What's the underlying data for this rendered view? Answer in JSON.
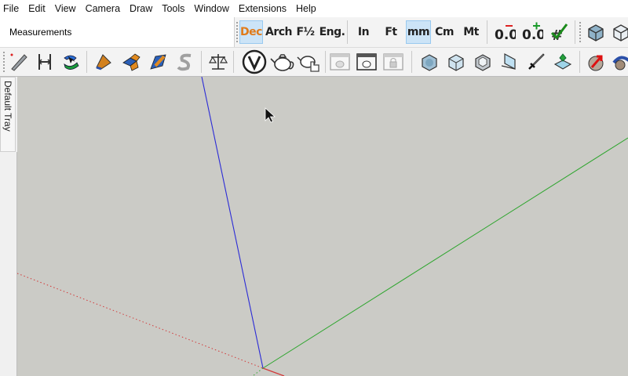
{
  "menubar": {
    "items": [
      "File",
      "Edit",
      "View",
      "Camera",
      "Draw",
      "Tools",
      "Window",
      "Extensions",
      "Help"
    ]
  },
  "measurements": {
    "label": "Measurements"
  },
  "units_toolbar": {
    "buttons": [
      {
        "label": "Dec",
        "active": true
      },
      {
        "label": "Arch",
        "active": false
      },
      {
        "label": "F½",
        "active": false
      },
      {
        "label": "Eng.",
        "active": false
      },
      {
        "label": "In",
        "active": false
      },
      {
        "label": "Ft",
        "active": false
      },
      {
        "label": "mm",
        "active": true
      },
      {
        "label": "Cm",
        "active": false
      },
      {
        "label": "Mt",
        "active": false
      }
    ],
    "precision_minus": "0.00",
    "precision_plus": "0.00",
    "hash_label": "#"
  },
  "tray": {
    "label": "Default Tray"
  },
  "colors": {
    "viewport_bg": "#cbcbc6",
    "axis_blue": "#2b2bd6",
    "axis_green": "#2da52d",
    "axis_red": "#d23a3a",
    "active_button_bg": "#cce4f7"
  },
  "icons": {
    "toolbar1_right": [
      "cube-icon",
      "cube-outline-icon"
    ],
    "toolbar2": [
      "pencil-icon",
      "dimension-icon",
      "follow-me-icon",
      "paint-bucket-icon",
      "push-pull-icon",
      "text-icon",
      "protractor-icon",
      "scale-icon",
      "vray-icon",
      "teapot-icon",
      "teapot-hand-icon",
      "frame-teapot-icon",
      "frame-render-icon",
      "frame-lock-icon",
      "cube-solid-icon",
      "cube-wire-icon",
      "cube-shaded-icon",
      "section-plane-icon",
      "sword-icon",
      "component-icon",
      "arrow-red-icon",
      "orbit-icon"
    ]
  }
}
